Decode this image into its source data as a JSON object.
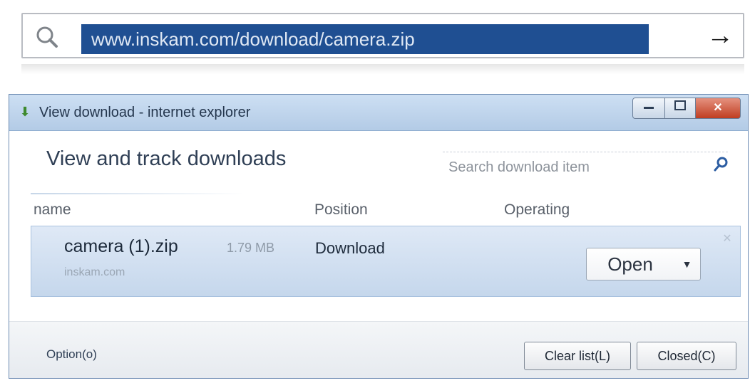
{
  "address_bar": {
    "search_icon": "magnifier-icon",
    "url": "www.inskam.com/download/camera.zip",
    "go_icon": "right-arrow-icon"
  },
  "window": {
    "title": "View download - internet explorer",
    "controls": {
      "minimize_icon": "minimize-icon",
      "maximize_icon": "maximize-icon",
      "close_icon": "close-icon"
    }
  },
  "panel": {
    "heading": "View and track downloads",
    "search_placeholder": "Search download item",
    "search_icon": "magnifier-icon"
  },
  "columns": [
    "name",
    "Position",
    "Operating"
  ],
  "downloads": [
    {
      "name": "camera (1).zip",
      "source": "inskam.com",
      "size": "1.79 MB",
      "status": "Download",
      "action": "Open"
    }
  ],
  "footer": {
    "options": "Option(o)",
    "clear": "Clear list(L)",
    "close": "Closed(C)"
  },
  "colors": {
    "url_highlight": "#1f4f92",
    "titlebar": "#b3cbe6",
    "row_background": "#c5d7ec",
    "close_button": "#c03d21"
  }
}
